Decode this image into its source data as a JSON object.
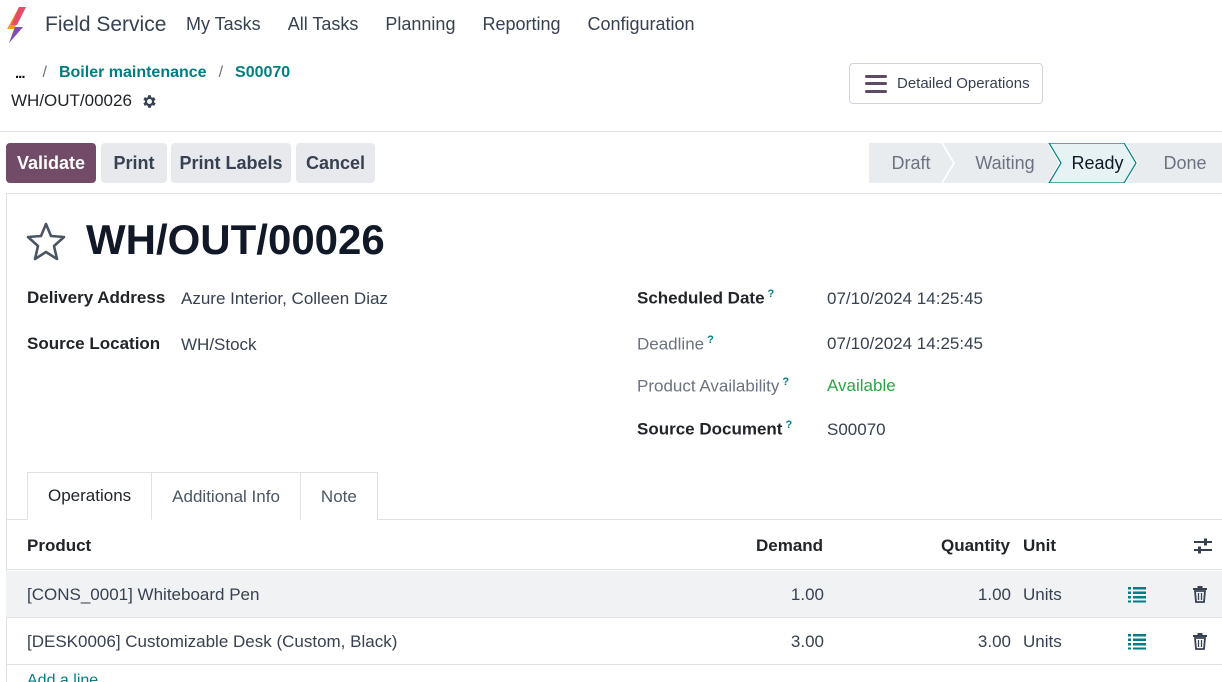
{
  "app": {
    "name": "Field Service"
  },
  "nav": {
    "items": [
      "My Tasks",
      "All Tasks",
      "Planning",
      "Reporting",
      "Configuration"
    ]
  },
  "breadcrumb": {
    "ellipsis": "...",
    "items": [
      "Boiler maintenance",
      "S00070"
    ],
    "current": "WH/OUT/00026"
  },
  "control": {
    "detailed_operations": "Detailed Operations"
  },
  "actions": {
    "validate": "Validate",
    "print": "Print",
    "print_labels": "Print Labels",
    "cancel": "Cancel"
  },
  "status": {
    "steps": [
      "Draft",
      "Waiting",
      "Ready",
      "Done"
    ],
    "active": "Ready"
  },
  "record": {
    "title": "WH/OUT/00026",
    "delivery_address": {
      "label": "Delivery Address",
      "value": "Azure Interior, Colleen Diaz"
    },
    "source_location": {
      "label": "Source Location",
      "value": "WH/Stock"
    },
    "scheduled_date": {
      "label": "Scheduled Date",
      "value": "07/10/2024 14:25:45"
    },
    "deadline": {
      "label": "Deadline",
      "value": "07/10/2024 14:25:45"
    },
    "availability": {
      "label": "Product Availability",
      "value": "Available"
    },
    "source_document": {
      "label": "Source Document",
      "value": "S00070"
    },
    "help_mark": "?"
  },
  "tabs": [
    "Operations",
    "Additional Info",
    "Note"
  ],
  "table": {
    "columns": {
      "product": "Product",
      "demand": "Demand",
      "quantity": "Quantity",
      "unit": "Unit"
    },
    "rows": [
      {
        "product": "[CONS_0001] Whiteboard Pen",
        "demand": "1.00",
        "quantity": "1.00",
        "unit": "Units"
      },
      {
        "product": "[DESK0006] Customizable Desk (Custom, Black)",
        "demand": "3.00",
        "quantity": "3.00",
        "unit": "Units"
      }
    ],
    "add_line": "Add a line"
  },
  "colors": {
    "primary": "#714b67",
    "link": "#017e84",
    "available": "#28a745",
    "ready_bg": "#e6f2f3"
  }
}
